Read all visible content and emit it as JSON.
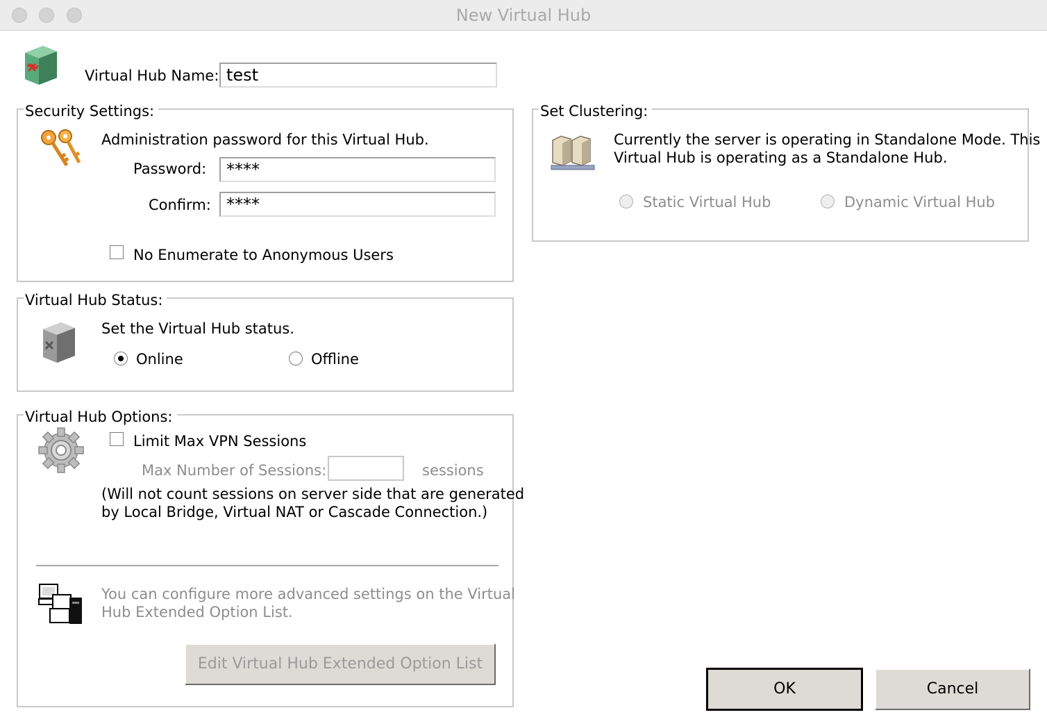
{
  "window": {
    "title": "New Virtual Hub"
  },
  "hub_name": {
    "label": "Virtual Hub Name:",
    "value": "test"
  },
  "security": {
    "legend": "Security Settings:",
    "description": "Administration password for this Virtual Hub.",
    "password_label": "Password:",
    "password_value": "****",
    "confirm_label": "Confirm:",
    "confirm_value": "****",
    "no_enumerate_label": "No Enumerate to Anonymous Users"
  },
  "status": {
    "legend": "Virtual Hub Status:",
    "description": "Set the Virtual Hub status.",
    "online_label": "Online",
    "offline_label": "Offline",
    "selected": "Online"
  },
  "options": {
    "legend": "Virtual Hub Options:",
    "limit_label": "Limit Max VPN Sessions",
    "max_sessions_label": "Max Number of Sessions:",
    "max_sessions_value": "",
    "sessions_unit": "sessions",
    "note_line1": "(Will not count sessions on server side that are generated",
    "note_line2": "by Local Bridge, Virtual NAT or Cascade Connection.)",
    "advanced_line1": "You can configure more advanced settings on the Virtual",
    "advanced_line2": "Hub Extended Option List.",
    "edit_button": "Edit Virtual Hub Extended Option List"
  },
  "clustering": {
    "legend": "Set Clustering:",
    "description_line1": "Currently the server is operating in Standalone Mode. This",
    "description_line2": "Virtual Hub is operating as a Standalone Hub.",
    "static_label": "Static Virtual Hub",
    "dynamic_label": "Dynamic Virtual Hub"
  },
  "buttons": {
    "ok": "OK",
    "cancel": "Cancel"
  },
  "icons": [
    "hub-icon",
    "keys-icon",
    "hub-status-icon",
    "gear-icon",
    "servers-icon",
    "computers-icon"
  ]
}
